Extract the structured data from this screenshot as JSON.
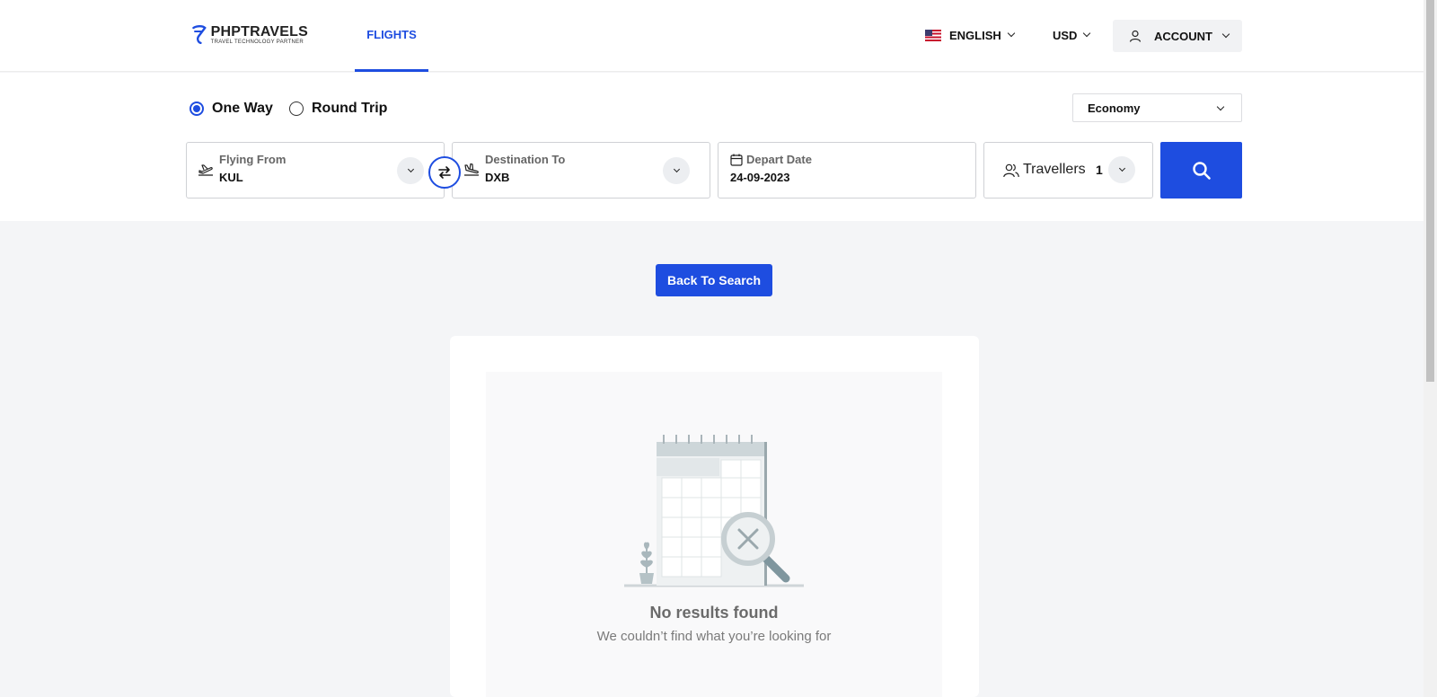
{
  "header": {
    "logo_main": "PHPTRAVELS",
    "logo_sub": "TRAVEL TECHNOLOGY PARTNER",
    "nav_flights": "FLIGHTS",
    "language": "ENGLISH",
    "currency": "USD",
    "account": "ACCOUNT"
  },
  "search": {
    "trip_types": [
      {
        "label": "One Way",
        "selected": true
      },
      {
        "label": "Round Trip",
        "selected": false
      }
    ],
    "cabin_class": "Economy",
    "flying_from_label": "Flying From",
    "flying_from_value": "KUL",
    "destination_label": "Destination To",
    "destination_value": "DXB",
    "depart_label": "Depart Date",
    "depart_value": "24-09-2023",
    "travellers_label": "Travellers",
    "travellers_count": "1"
  },
  "results": {
    "back_button": "Back To Search",
    "empty_title": "No results found",
    "empty_subtitle": "We couldn’t find what you’re looking for"
  },
  "colors": {
    "accent": "#1e4de0",
    "page_bg": "#f4f5f7"
  },
  "icons": [
    "plane-takeoff-icon",
    "plane-landing-icon",
    "swap-icon",
    "calendar-icon",
    "users-icon",
    "search-icon",
    "user-icon",
    "us-flag-icon",
    "chevron-down-icon"
  ]
}
